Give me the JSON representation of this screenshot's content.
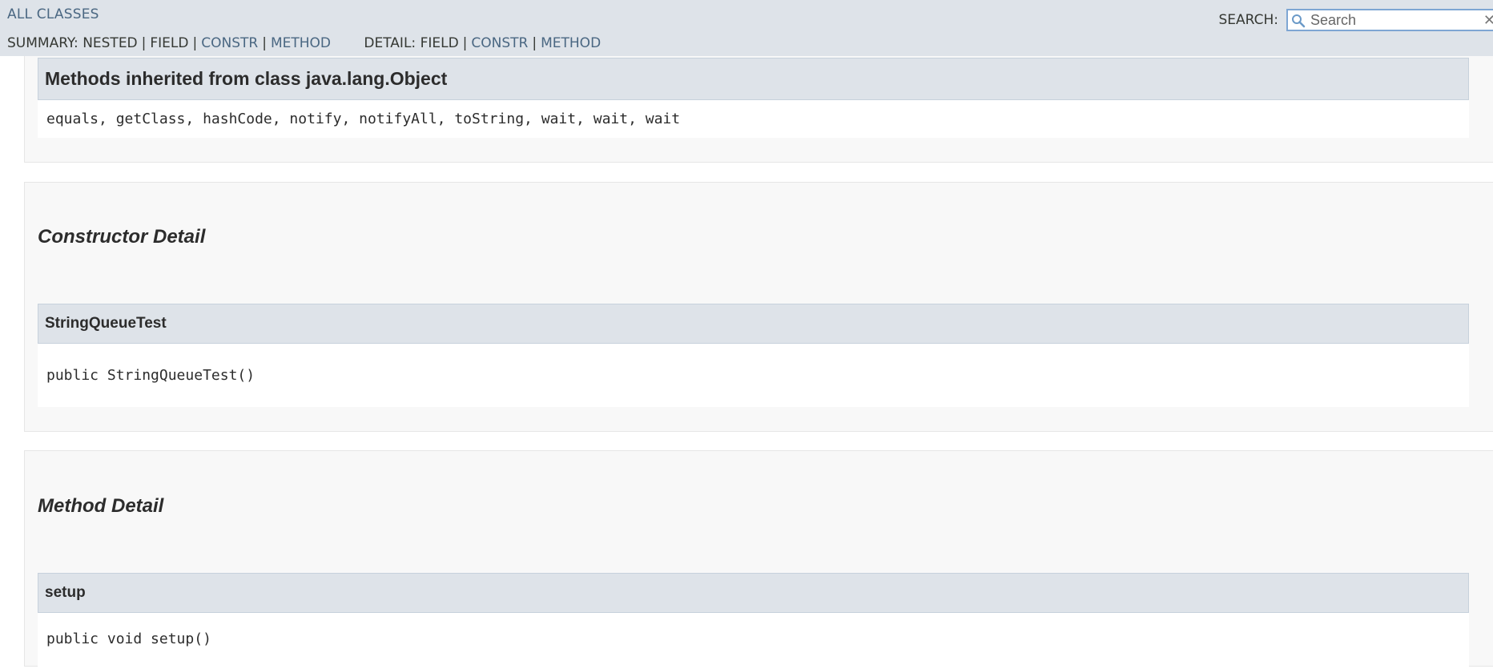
{
  "nav": {
    "all_classes": "ALL CLASSES",
    "summary_label": "SUMMARY:",
    "summary_nested": "NESTED",
    "summary_field": "FIELD",
    "summary_constr": "CONSTR",
    "summary_method": "METHOD",
    "detail_label": "DETAIL:",
    "detail_field": "FIELD",
    "detail_constr": "CONSTR",
    "detail_method": "METHOD",
    "separator": "|"
  },
  "search": {
    "label": "SEARCH:",
    "value": "",
    "placeholder": "Search",
    "reset_icon": "close-icon",
    "icon": "magnifier-icon"
  },
  "inherited": {
    "title": "Methods inherited from class java.lang.Object",
    "methods": "equals, getClass, hashCode, notify, notifyAll, toString, wait, wait, wait"
  },
  "constructor_detail": {
    "heading": "Constructor Detail",
    "name": "StringQueueTest",
    "signature": "public StringQueueTest()"
  },
  "method_detail": {
    "heading": "Method Detail",
    "name": "setup",
    "signature": "public void setup()"
  },
  "colors": {
    "nav_bg": "#dee3e9",
    "link": "#4a6782",
    "panel_bg": "#f8f8f8"
  }
}
